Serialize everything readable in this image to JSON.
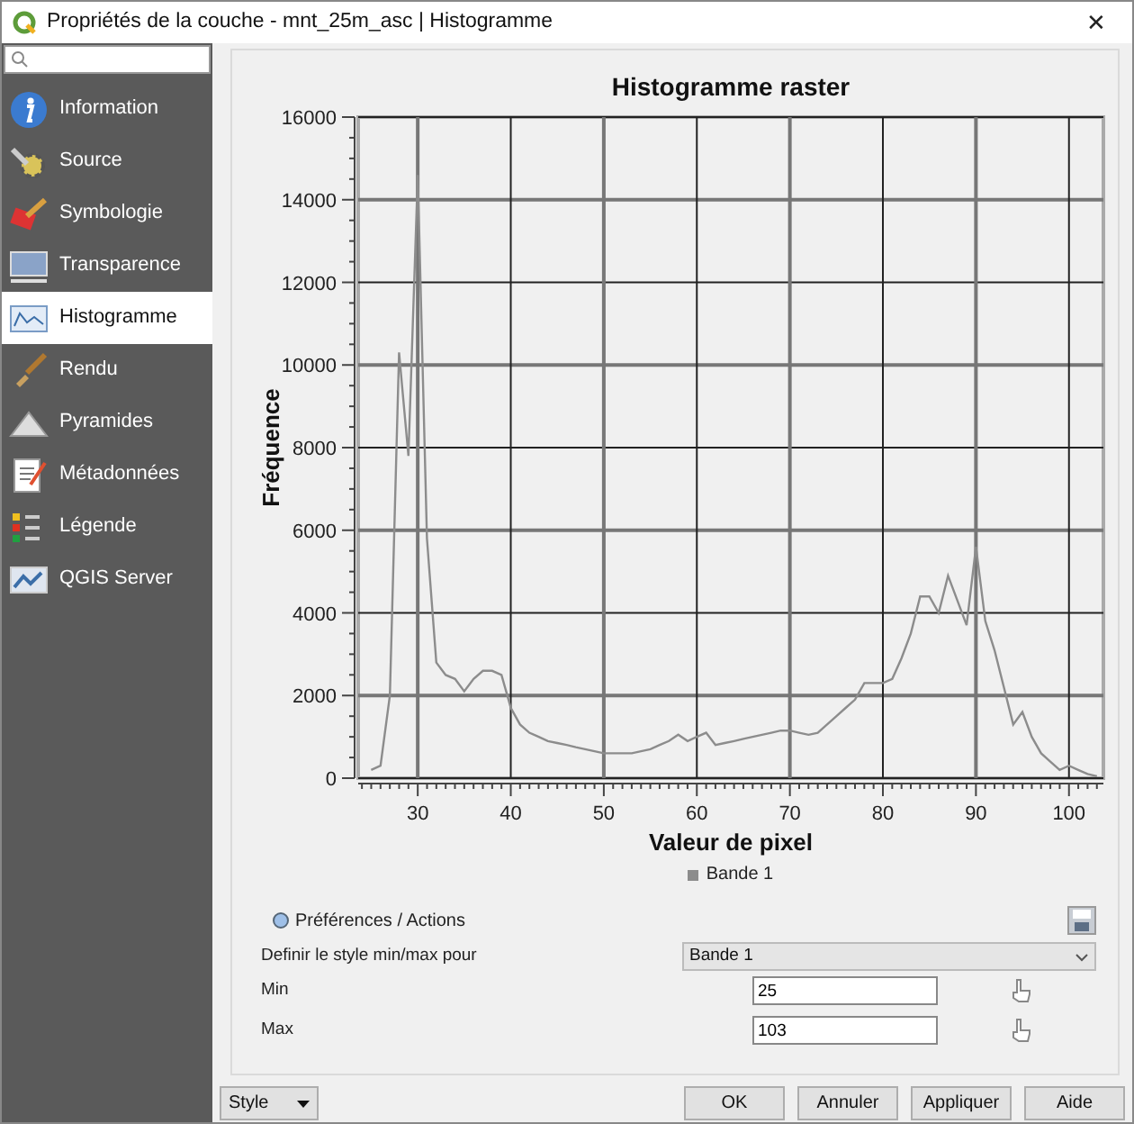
{
  "window": {
    "title": "Propriétés de la couche - mnt_25m_asc | Histogramme",
    "close": "✕"
  },
  "sidebar": {
    "items": [
      {
        "label": "Information",
        "kind": "info",
        "selected": false
      },
      {
        "label": "Source",
        "kind": "source",
        "selected": false
      },
      {
        "label": "Symbologie",
        "kind": "symbology",
        "selected": false
      },
      {
        "label": "Transparence",
        "kind": "transparency",
        "selected": false
      },
      {
        "label": "Histogramme",
        "kind": "histogram",
        "selected": true
      },
      {
        "label": "Rendu",
        "kind": "rendering",
        "selected": false
      },
      {
        "label": "Pyramides",
        "kind": "pyramids",
        "selected": false
      },
      {
        "label": "Métadonnées",
        "kind": "metadata",
        "selected": false
      },
      {
        "label": "Légende",
        "kind": "legend",
        "selected": false
      },
      {
        "label": "QGIS Server",
        "kind": "server",
        "selected": false
      }
    ]
  },
  "histogram": {
    "chart_data": {
      "type": "line",
      "grid": true,
      "title": "Histogramme raster",
      "xlabel": "Valeur de pixel",
      "ylabel": "Fréquence",
      "xlim": [
        23.6,
        103.7
      ],
      "ylim": [
        0,
        16000
      ],
      "xticks": [
        30,
        40,
        50,
        60,
        70,
        80,
        90,
        100
      ],
      "yticks": [
        0,
        2000,
        4000,
        6000,
        8000,
        10000,
        12000,
        14000,
        16000
      ],
      "x": [
        25,
        26,
        27,
        28,
        29,
        30,
        31,
        32,
        33,
        34,
        35,
        36,
        37,
        38,
        39,
        40,
        41,
        42,
        43,
        44,
        45,
        46,
        47,
        48,
        49,
        50,
        51,
        52,
        53,
        54,
        55,
        56,
        57,
        58,
        59,
        60,
        61,
        62,
        63,
        64,
        65,
        66,
        67,
        68,
        69,
        70,
        71,
        72,
        73,
        74,
        75,
        76,
        77,
        78,
        79,
        80,
        81,
        82,
        83,
        84,
        85,
        86,
        87,
        88,
        89,
        90,
        91,
        92,
        93,
        94,
        95,
        96,
        97,
        98,
        99,
        100,
        101,
        102,
        103
      ],
      "series": [
        {
          "name": "Bande 1",
          "color": "#8c8c8c",
          "values": [
            200,
            300,
            2000,
            10300,
            7800,
            14600,
            5800,
            2800,
            2500,
            2400,
            2100,
            2400,
            2600,
            2600,
            2500,
            1700,
            1300,
            1100,
            1000,
            900,
            850,
            800,
            750,
            700,
            650,
            600,
            600,
            600,
            600,
            650,
            700,
            800,
            900,
            1050,
            900,
            1000,
            1100,
            800,
            850,
            900,
            950,
            1000,
            1050,
            1100,
            1150,
            1150,
            1100,
            1050,
            1100,
            1300,
            1500,
            1700,
            1900,
            2300,
            2300,
            2300,
            2400,
            2900,
            3500,
            4400,
            4400,
            4000,
            4900,
            4300,
            3700,
            5600,
            3800,
            3100,
            2200,
            1300,
            1600,
            1000,
            600,
            400,
            200,
            300,
            200,
            100,
            50
          ]
        }
      ]
    }
  },
  "preferences": {
    "label": "Préférences / Actions"
  },
  "minmax": {
    "label": "Definir le style min/max pour",
    "band": "Bande 1",
    "min_label": "Min",
    "min": "25",
    "max_label": "Max",
    "max": "103"
  },
  "buttons": {
    "style": "Style",
    "ok": "OK",
    "cancel": "Annuler",
    "apply": "Appliquer",
    "help": "Aide"
  }
}
